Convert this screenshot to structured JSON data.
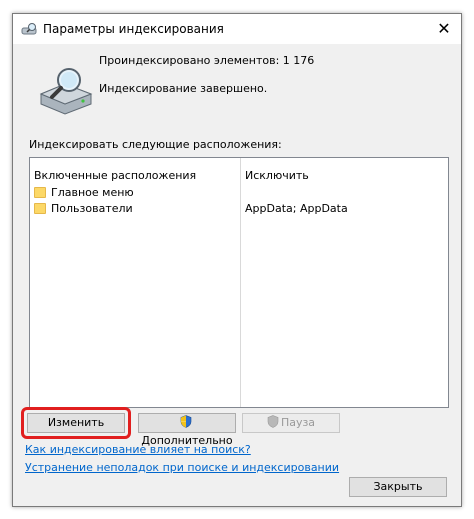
{
  "window": {
    "title": "Параметры индексирования",
    "close_glyph": "✕"
  },
  "status": {
    "indexed_count_text": "Проиндексировано элементов: 1 176",
    "state_text": "Индексирование завершено."
  },
  "locations_label": "Индексировать следующие расположения:",
  "table": {
    "headers": {
      "included": "Включенные расположения",
      "exclude": "Исключить"
    },
    "rows": [
      {
        "location": "Главное меню",
        "exclude": ""
      },
      {
        "location": "Пользователи",
        "exclude": "AppData; AppData"
      }
    ]
  },
  "buttons": {
    "modify": "Изменить",
    "advanced": "Дополнительно",
    "pause": "Пауза",
    "close": "Закрыть"
  },
  "links": {
    "how_affects": "Как индексирование влияет на поиск?",
    "troubleshoot": "Устранение неполадок при поиске и индексировании"
  },
  "colors": {
    "highlight": "#e11f1f",
    "link": "#0066cc"
  }
}
